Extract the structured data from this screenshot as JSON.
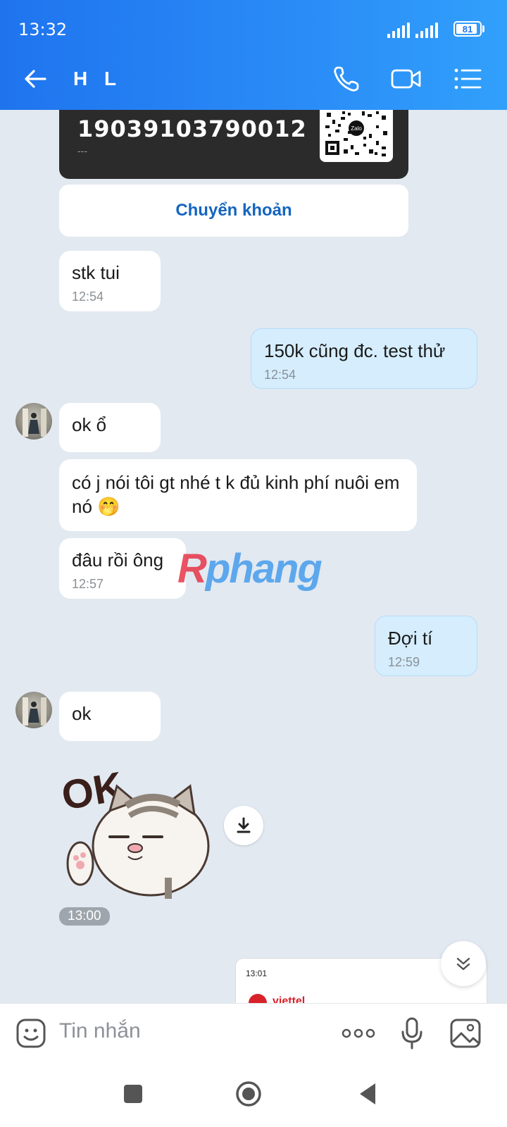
{
  "status_bar": {
    "time": "13:32",
    "battery": "81"
  },
  "header": {
    "contact_name": "H L"
  },
  "bank_card": {
    "account_number": "19039103790012",
    "sub": "---",
    "qr_brand": "Zalo"
  },
  "transfer_button": "Chuyển khoản",
  "messages": [
    {
      "text": "stk tui",
      "time": "12:54"
    },
    {
      "text": "150k cũng đc. test thử",
      "time": "12:54"
    },
    {
      "text": "ok ổ"
    },
    {
      "text": "có j nói tôi gt nhé t k đủ kinh phí nuôi em nó 🤭"
    },
    {
      "text": "đâu rồi ông",
      "time": "12:57"
    },
    {
      "text": "Đợi tí",
      "time": "12:59"
    },
    {
      "text": "ok"
    }
  ],
  "sticker": {
    "text": "OK",
    "time": "13:00"
  },
  "shared_screenshot": {
    "time": "13:01",
    "brand": "viettel"
  },
  "watermark": {
    "part1": "R",
    "part2": "phang"
  },
  "composer": {
    "placeholder": "Tin nhắn"
  },
  "colors": {
    "header": "#1f74ee",
    "chat_bg": "#e2e9f1",
    "my_bubble": "#d5edfd",
    "link": "#1565c0"
  }
}
